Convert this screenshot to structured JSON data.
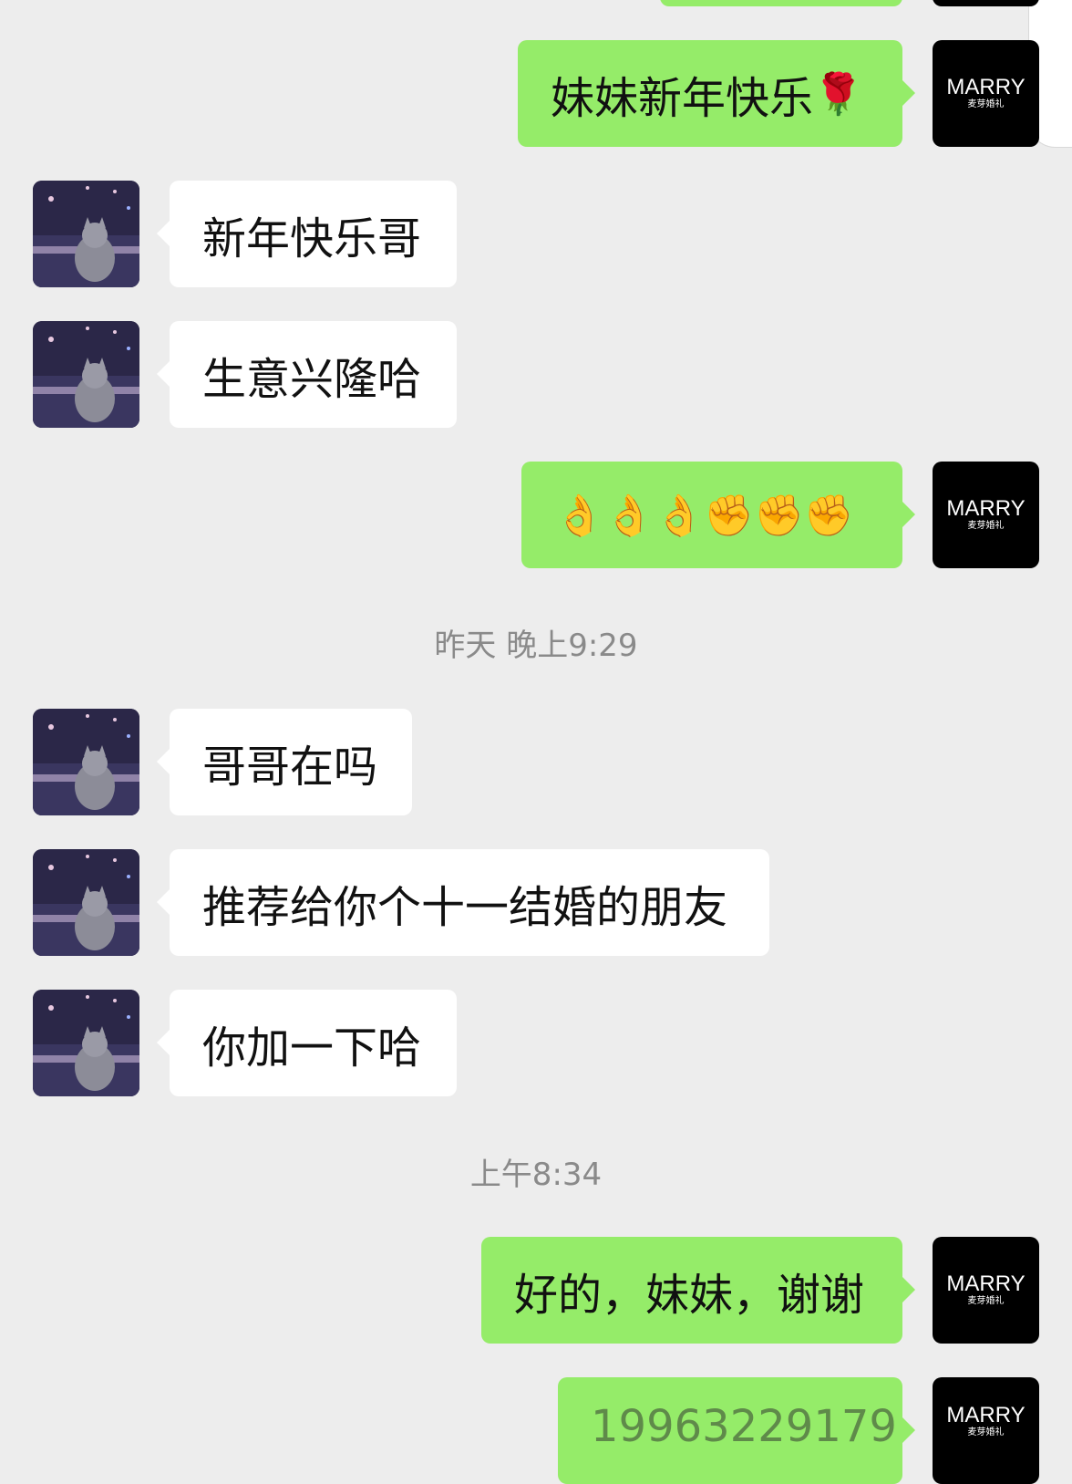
{
  "self_avatar": {
    "brand": "MARRY",
    "subtitle": "麦芽婚礼"
  },
  "messages": [
    {
      "from": "self",
      "text": ""
    },
    {
      "from": "self",
      "text": "妹妹新年快乐",
      "emoji": "🌹"
    },
    {
      "from": "friend",
      "text": "新年快乐哥"
    },
    {
      "from": "friend",
      "text": "生意兴隆哈"
    },
    {
      "from": "self",
      "text": "",
      "emoji": "👌👌👌✊✊✊"
    },
    {
      "from": "friend",
      "text": "哥哥在吗"
    },
    {
      "from": "friend",
      "text": "推荐给你个十一结婚的朋友"
    },
    {
      "from": "friend",
      "text": "你加一下哈"
    },
    {
      "from": "self",
      "text": "好的，妹妹，谢谢"
    },
    {
      "from": "self",
      "text": "19963229179"
    }
  ],
  "timestamps": [
    "昨天 晚上9:29",
    "上午8:34"
  ],
  "colors": {
    "background": "#ededed",
    "outgoing_bubble": "#95ec69",
    "incoming_bubble": "#ffffff",
    "timestamp_text": "#8a8a8a"
  },
  "icons": {
    "friend_avatar": "cat-night-scene-avatar",
    "self_avatar": "marry-logo-avatar"
  }
}
